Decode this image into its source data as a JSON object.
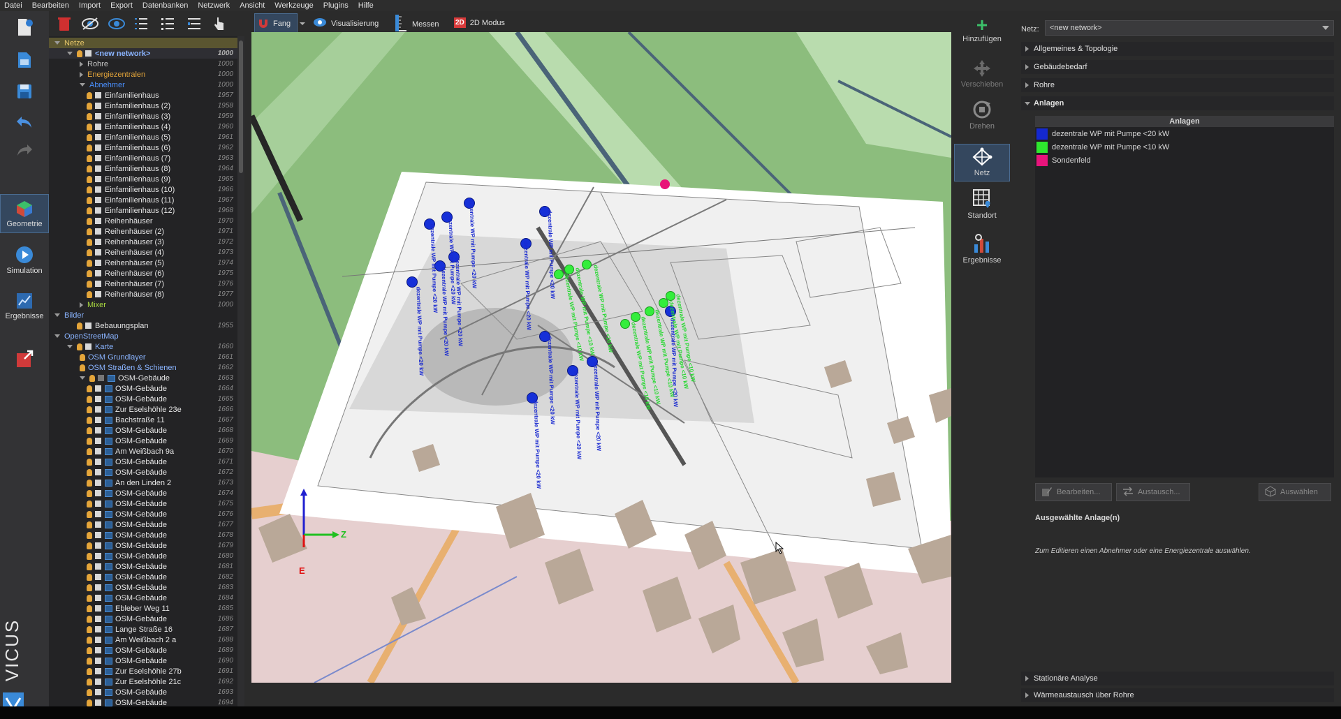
{
  "menu": [
    "Datei",
    "Bearbeiten",
    "Import",
    "Export",
    "Datenbanken",
    "Netzwerk",
    "Ansicht",
    "Werkzeuge",
    "Plugins",
    "Hilfe"
  ],
  "leftbar": {
    "geometrie": "Geometrie",
    "simulation": "Simulation",
    "ergebnisse": "Ergebnisse",
    "brand": "VICUS"
  },
  "toolbar": {
    "fang": "Fang",
    "visualisierung": "Visualisierung",
    "messen": "Messen",
    "modus_badge": "2D",
    "modus": "2D Modus"
  },
  "tree": {
    "netze": "Netze",
    "new_network": "<new network>",
    "new_network_id": "1000",
    "rohre": "Rohre",
    "rohre_id": "1000",
    "energiezentralen": "Energiezentralen",
    "energiezentralen_id": "1000",
    "abnehmer": "Abnehmer",
    "abnehmer_id": "1000",
    "abnehmer_items": [
      {
        "label": "Einfamilienhaus",
        "id": "1957"
      },
      {
        "label": "Einfamilienhaus (2)",
        "id": "1958"
      },
      {
        "label": "Einfamilienhaus (3)",
        "id": "1959"
      },
      {
        "label": "Einfamilienhaus (4)",
        "id": "1960"
      },
      {
        "label": "Einfamilienhaus (5)",
        "id": "1961"
      },
      {
        "label": "Einfamilienhaus (6)",
        "id": "1962"
      },
      {
        "label": "Einfamilienhaus (7)",
        "id": "1963"
      },
      {
        "label": "Einfamilienhaus (8)",
        "id": "1964"
      },
      {
        "label": "Einfamilienhaus (9)",
        "id": "1965"
      },
      {
        "label": "Einfamilienhaus (10)",
        "id": "1966"
      },
      {
        "label": "Einfamilienhaus (11)",
        "id": "1967"
      },
      {
        "label": "Einfamilienhaus (12)",
        "id": "1968"
      },
      {
        "label": "Reihenhäuser",
        "id": "1970"
      },
      {
        "label": "Reihenhäuser (2)",
        "id": "1971"
      },
      {
        "label": "Reihenhäuser (3)",
        "id": "1972"
      },
      {
        "label": "Reihenhäuser (4)",
        "id": "1973"
      },
      {
        "label": "Reihenhäuser (5)",
        "id": "1974"
      },
      {
        "label": "Reihenhäuser (6)",
        "id": "1975"
      },
      {
        "label": "Reihenhäuser (7)",
        "id": "1976"
      },
      {
        "label": "Reihenhäuser (8)",
        "id": "1977"
      }
    ],
    "mixer": "Mixer",
    "mixer_id": "1000",
    "bilder": "Bilder",
    "bebauungsplan": "Bebauungsplan",
    "bebauungsplan_id": "1955",
    "osm": "OpenStreetMap",
    "karte": "Karte",
    "karte_id": "1660",
    "osm_grundlayer": "OSM Grundlayer",
    "osm_grundlayer_id": "1661",
    "osm_strassen": "OSM Straßen & Schienen",
    "osm_strassen_id": "1662",
    "osm_gebaeude": "OSM-Gebäude",
    "osm_gebaeude_id": "1663",
    "osm_items": [
      {
        "label": "OSM-Gebäude",
        "id": "1664"
      },
      {
        "label": "OSM-Gebäude",
        "id": "1665"
      },
      {
        "label": "Zur Eselshöhle 23e",
        "id": "1666"
      },
      {
        "label": "Bachstraße 11",
        "id": "1667"
      },
      {
        "label": "OSM-Gebäude",
        "id": "1668"
      },
      {
        "label": "OSM-Gebäude",
        "id": "1669"
      },
      {
        "label": "Am Weißbach 9a",
        "id": "1670"
      },
      {
        "label": "OSM-Gebäude",
        "id": "1671"
      },
      {
        "label": "OSM-Gebäude",
        "id": "1672"
      },
      {
        "label": "An den Linden 2",
        "id": "1673"
      },
      {
        "label": "OSM-Gebäude",
        "id": "1674"
      },
      {
        "label": "OSM-Gebäude",
        "id": "1675"
      },
      {
        "label": "OSM-Gebäude",
        "id": "1676"
      },
      {
        "label": "OSM-Gebäude",
        "id": "1677"
      },
      {
        "label": "OSM-Gebäude",
        "id": "1678"
      },
      {
        "label": "OSM-Gebäude",
        "id": "1679"
      },
      {
        "label": "OSM-Gebäude",
        "id": "1680"
      },
      {
        "label": "OSM-Gebäude",
        "id": "1681"
      },
      {
        "label": "OSM-Gebäude",
        "id": "1682"
      },
      {
        "label": "OSM-Gebäude",
        "id": "1683"
      },
      {
        "label": "OSM-Gebäude",
        "id": "1684"
      },
      {
        "label": "Ebleber Weg 11",
        "id": "1685"
      },
      {
        "label": "OSM-Gebäude",
        "id": "1686"
      },
      {
        "label": "Lange Straße 16",
        "id": "1687"
      },
      {
        "label": "Am Weißbach 2 a",
        "id": "1688"
      },
      {
        "label": "OSM-Gebäude",
        "id": "1689"
      },
      {
        "label": "OSM-Gebäude",
        "id": "1690"
      },
      {
        "label": "Zur Eselshöhle 27b",
        "id": "1691"
      },
      {
        "label": "Zur Eselshöhle 21c",
        "id": "1692"
      },
      {
        "label": "OSM-Gebäude",
        "id": "1693"
      },
      {
        "label": "OSM-Gebäude",
        "id": "1694"
      }
    ]
  },
  "viewport": {
    "labels_blue": [
      "dezentrale WP mit Pumpe <20 kW"
    ],
    "labels_green": [
      "dezentrale WP mit Pumpe <10 kW"
    ],
    "axis_z": "Z",
    "axis_e": "E"
  },
  "midbar": {
    "hinzufuegen": "Hinzufügen",
    "verschieben": "Verschieben",
    "drehen": "Drehen",
    "netz": "Netz",
    "standort": "Standort",
    "ergebnisse": "Ergebnisse"
  },
  "right": {
    "netz_label": "Netz:",
    "netz_value": "<new network>",
    "sections": {
      "allgemeines": "Allgemeines & Topologie",
      "gebaeudebedarf": "Gebäudebedarf",
      "rohre": "Rohre",
      "anlagen": "Anlagen"
    },
    "anlagen_header": "Anlagen",
    "anlagen": [
      {
        "label": "dezentrale WP mit Pumpe <20 kW",
        "color": "#1428d0"
      },
      {
        "label": "dezentrale WP mit Pumpe <10 kW",
        "color": "#2ee82e"
      },
      {
        "label": "Sondenfeld",
        "color": "#e8147c"
      }
    ],
    "btn_bearbeiten": "Bearbeiten...",
    "btn_austausch": "Austausch...",
    "btn_auswaehlen": "Auswählen",
    "selected_title": "Ausgewählte Anlage(n)",
    "hint": "Zum Editieren einen Abnehmer oder eine Energiezentrale auswählen.",
    "stationaer": "Stationäre Analyse",
    "waermeaustausch": "Wärmeaustausch über Rohre"
  }
}
